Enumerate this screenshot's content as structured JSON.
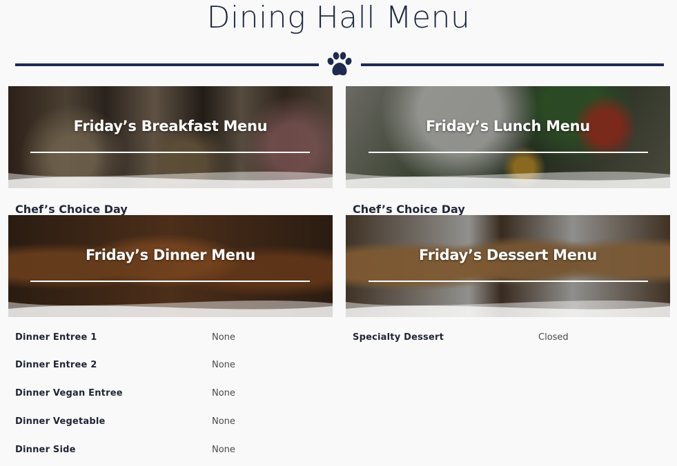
{
  "page": {
    "title": "Dining Hall Menu",
    "divider_icon": "paw-icon",
    "accent_color": "#1e2b4e"
  },
  "banners": {
    "breakfast": {
      "title": "Friday’s Breakfast Menu"
    },
    "lunch": {
      "title": "Friday’s Lunch Menu"
    },
    "dinner": {
      "title": "Friday’s Dinner Menu"
    },
    "dessert": {
      "title": "Friday’s Dessert Menu"
    }
  },
  "breakfast": {
    "note": "Chef’s Choice Day"
  },
  "lunch": {
    "note": "Chef’s Choice Day"
  },
  "dinner": {
    "items": [
      {
        "label": "Dinner Entree 1",
        "value": "None"
      },
      {
        "label": "Dinner Entree 2",
        "value": "None"
      },
      {
        "label": "Dinner Vegan Entree",
        "value": "None"
      },
      {
        "label": "Dinner Vegetable",
        "value": "None"
      },
      {
        "label": "Dinner Side",
        "value": "None"
      }
    ]
  },
  "dessert": {
    "items": [
      {
        "label": "Specialty Dessert",
        "value": "Closed"
      }
    ]
  }
}
